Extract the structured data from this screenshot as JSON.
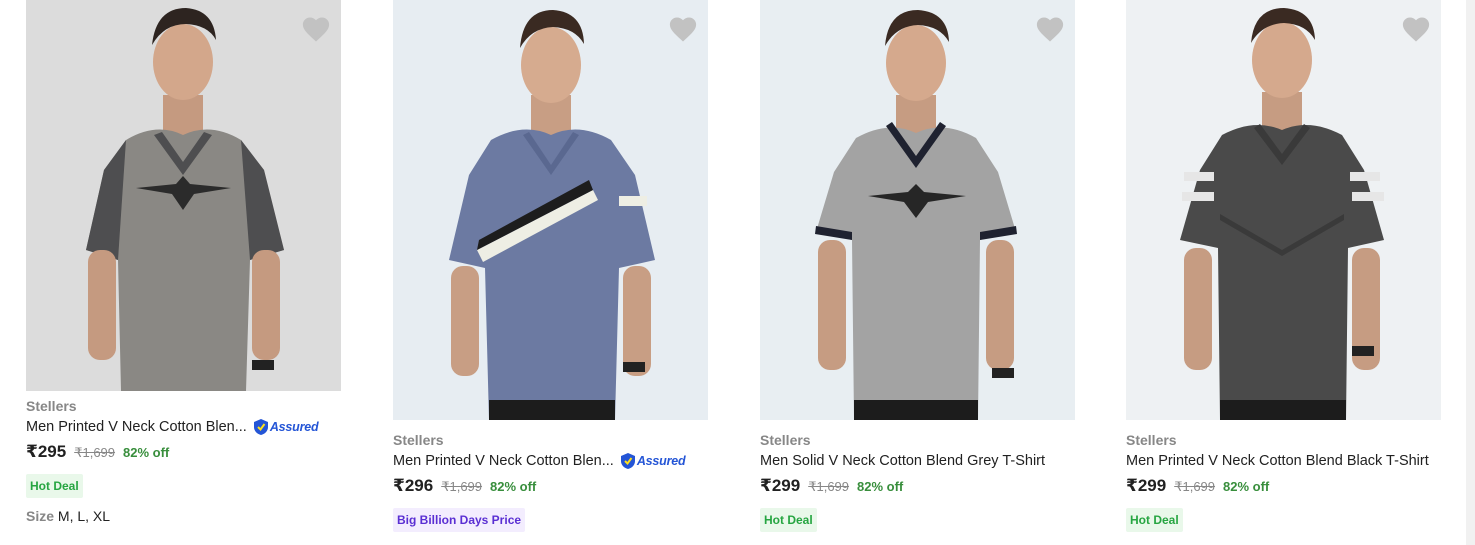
{
  "colors": {
    "brand_grey": "#878787",
    "discount_green": "#388e3c",
    "hot_deal_text": "#26a541",
    "hot_deal_bg": "#e9f8ea",
    "bbd_text": "#5a2fd3",
    "bbd_bg": "#f3edfe",
    "assured_blue": "#2455d6"
  },
  "products": [
    {
      "brand": "Stellers",
      "title": "Men Printed V Neck Cotton Blen...",
      "assured_label": "Assured",
      "price": "₹295",
      "mrp": "₹1,699",
      "discount": "82% off",
      "badge": "Hot Deal",
      "size_label": "Size",
      "sizes": "M, L, XL",
      "image_icon": "grey-tshirt-photo"
    },
    {
      "brand": "Stellers",
      "title": "Men Printed V Neck Cotton Blen...",
      "assured_label": "Assured",
      "price": "₹296",
      "mrp": "₹1,699",
      "discount": "82% off",
      "badge": "Big Billion Days Price",
      "image_icon": "blue-tshirt-photo"
    },
    {
      "brand": "Stellers",
      "title": "Men Solid V Neck Cotton Blend Grey T-Shirt",
      "price": "₹299",
      "mrp": "₹1,699",
      "discount": "82% off",
      "badge": "Hot Deal",
      "image_icon": "light-grey-tshirt-photo"
    },
    {
      "brand": "Stellers",
      "title": "Men Printed V Neck Cotton Blend Black T-Shirt",
      "price": "₹299",
      "mrp": "₹1,699",
      "discount": "82% off",
      "badge": "Hot Deal",
      "image_icon": "black-tshirt-photo"
    }
  ]
}
